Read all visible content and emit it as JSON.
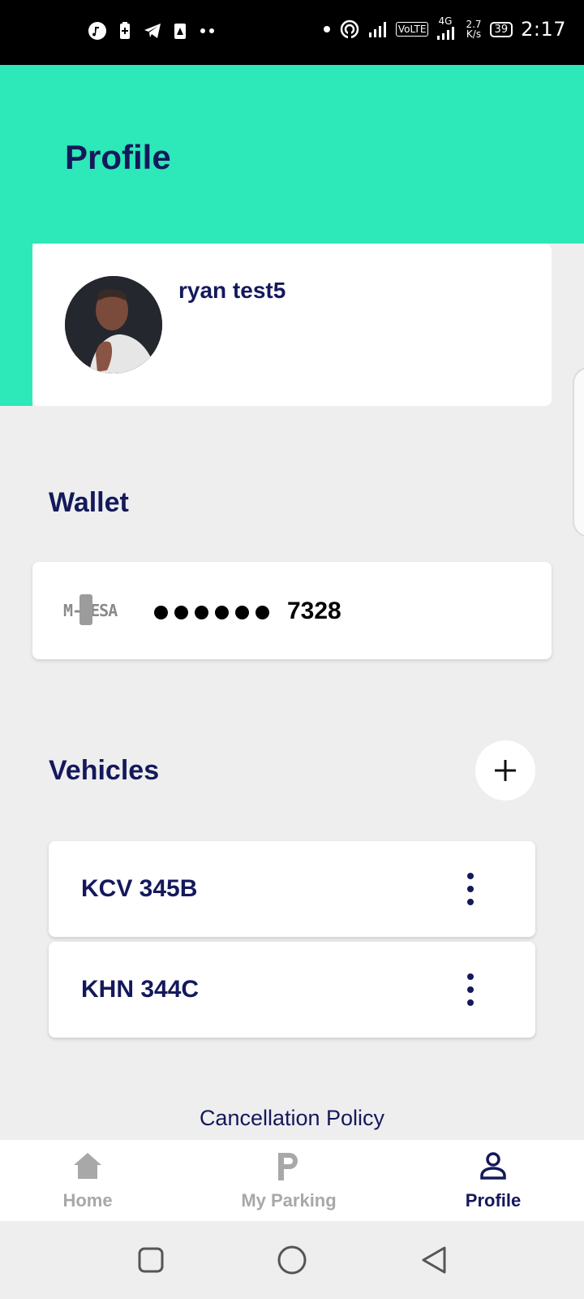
{
  "status_bar": {
    "time": "2:17",
    "network_speed_top": "2.7",
    "network_speed_bottom": "K/s",
    "lte_badge": "VoLTE",
    "network_type": "4G",
    "battery_level": "39",
    "left_icons": [
      "music-icon",
      "battery-saver-icon",
      "telegram-icon",
      "alert-icon",
      "more-dots-icon"
    ],
    "right_icons": [
      "dot-icon",
      "hotspot-icon",
      "signal-icon",
      "signal-icon"
    ]
  },
  "header": {
    "title": "Profile",
    "accent_color": "#2de8b8"
  },
  "profile": {
    "name": "ryan test5"
  },
  "wallet": {
    "title": "Wallet",
    "provider_logo": "M-PESA",
    "masked_prefix_dots": 6,
    "number_suffix": "7328"
  },
  "vehicles": {
    "title": "Vehicles",
    "items": [
      {
        "plate": "KCV 345B"
      },
      {
        "plate": "KHN 344C"
      }
    ]
  },
  "links": {
    "cancellation_policy": "Cancellation Policy"
  },
  "bottom_nav": {
    "items": [
      {
        "label": "Home",
        "icon": "home-icon",
        "active": false
      },
      {
        "label": "My Parking",
        "icon": "parking-icon",
        "active": false
      },
      {
        "label": "Profile",
        "icon": "user-icon",
        "active": true
      }
    ]
  },
  "colors": {
    "primary_text": "#14195c",
    "inactive": "#a8a8a8",
    "background": "#eeeeee"
  }
}
